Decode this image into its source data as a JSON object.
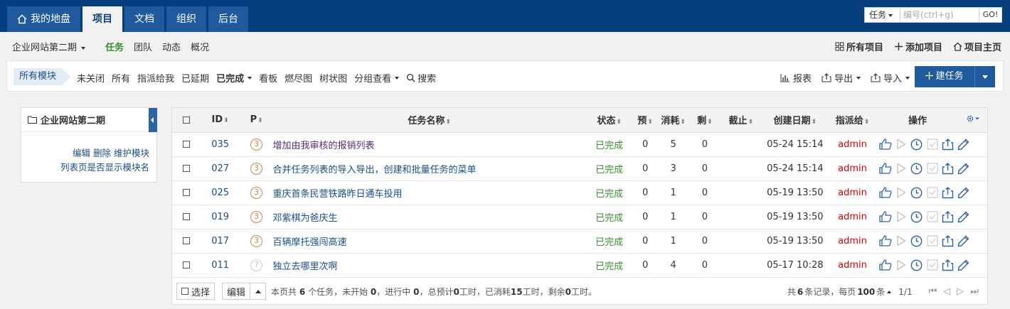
{
  "topnav": {
    "tabs": [
      {
        "label": "我的地盘",
        "icon": "home-icon",
        "active": false
      },
      {
        "label": "项目",
        "active": true
      },
      {
        "label": "文档",
        "active": false
      },
      {
        "label": "组织",
        "active": false
      },
      {
        "label": "后台",
        "active": false
      }
    ],
    "search": {
      "type": "任务",
      "placeholder": "编号(ctrl+g)",
      "value": "",
      "go": "GO!"
    }
  },
  "subnav": {
    "project": "企业网站第二期",
    "links": [
      {
        "label": "任务",
        "active": true
      },
      {
        "label": "团队",
        "active": false
      },
      {
        "label": "动态",
        "active": false
      },
      {
        "label": "概况",
        "active": false
      }
    ],
    "right": [
      {
        "label": "所有项目",
        "icon": "grid-icon"
      },
      {
        "label": "添加项目",
        "icon": "plus-icon"
      },
      {
        "label": "项目主页",
        "icon": "home-icon"
      }
    ]
  },
  "toolbar": {
    "module": "所有模块",
    "filters": [
      {
        "label": "未关闭"
      },
      {
        "label": "所有"
      },
      {
        "label": "指派给我"
      },
      {
        "label": "已延期"
      },
      {
        "label": "已完成",
        "bold": true,
        "dropdown": true
      },
      {
        "label": "看板"
      },
      {
        "label": "燃尽图"
      },
      {
        "label": "树状图"
      },
      {
        "label": "分组查看",
        "dropdown": true
      },
      {
        "label": "搜索",
        "icon": "search-icon"
      }
    ],
    "report": "报表",
    "export": "导出",
    "import": "导入",
    "new_task": "建任务"
  },
  "sidebar": {
    "title": "企业网站第二期",
    "links_line1": [
      "编辑",
      "删除",
      "维护模块"
    ],
    "links_line2": "列表页是否显示模块名"
  },
  "table": {
    "headers": {
      "id": "ID",
      "pri": "P",
      "name": "任务名称",
      "status": "状态",
      "estimate": "预",
      "consumed": "消耗",
      "left": "剩",
      "deadline": "截止",
      "created": "创建日期",
      "assigned": "指派给",
      "actions": "操作"
    },
    "rows": [
      {
        "id": "035",
        "pri": "3",
        "name": "增加由我审核的报销列表",
        "status": "已完成",
        "estimate": "0",
        "consumed": "5",
        "left": "0",
        "deadline": "",
        "created": "05-24 15:14",
        "assigned": "admin"
      },
      {
        "id": "027",
        "pri": "3",
        "name": "合并任务列表的导入导出，创建和批量任务的菜单",
        "status": "已完成",
        "estimate": "0",
        "consumed": "3",
        "left": "0",
        "deadline": "",
        "created": "05-24 15:14",
        "assigned": "admin"
      },
      {
        "id": "025",
        "pri": "3",
        "name": "重庆首条民营铁路昨日通车投用",
        "status": "已完成",
        "estimate": "0",
        "consumed": "1",
        "left": "0",
        "deadline": "",
        "created": "05-19 13:50",
        "assigned": "admin"
      },
      {
        "id": "019",
        "pri": "3",
        "name": "邓紫棋为爸庆生",
        "status": "已完成",
        "estimate": "0",
        "consumed": "1",
        "left": "0",
        "deadline": "",
        "created": "05-19 13:50",
        "assigned": "admin"
      },
      {
        "id": "017",
        "pri": "3",
        "name": "百辆摩托强闯高速",
        "status": "已完成",
        "estimate": "0",
        "consumed": "1",
        "left": "0",
        "deadline": "",
        "created": "05-19 13:50",
        "assigned": "admin"
      },
      {
        "id": "011",
        "pri": "?",
        "name": "独立去哪里次啊",
        "status": "已完成",
        "estimate": "0",
        "consumed": "4",
        "left": "0",
        "deadline": "",
        "created": "05-17 10:28",
        "assigned": "admin"
      }
    ]
  },
  "footer": {
    "select_label": "选择",
    "edit_label": "编辑",
    "summary_prefix": "本页共",
    "count": "6",
    "summary_1": "个任务，未开始",
    "not_started": "0",
    "summary_2": "，进行中",
    "in_progress": "0",
    "summary_3": "，总预计",
    "total_estimate": "0",
    "summary_4": "工时，已消耗",
    "total_consumed": "15",
    "summary_5": "工时，剩余",
    "total_left": "0",
    "summary_6": "工时。",
    "pager_prefix": "共",
    "records": "6",
    "pager_mid": "条记录，每页",
    "per_page": "100",
    "pager_unit": "条",
    "page": "1/1"
  },
  "colors": {
    "nav_bg": "#053e7d",
    "primary": "#1f5b9c",
    "done_green": "#3a8f2f",
    "owner_red": "#dd0000",
    "link_blue": "#1a4f85"
  }
}
